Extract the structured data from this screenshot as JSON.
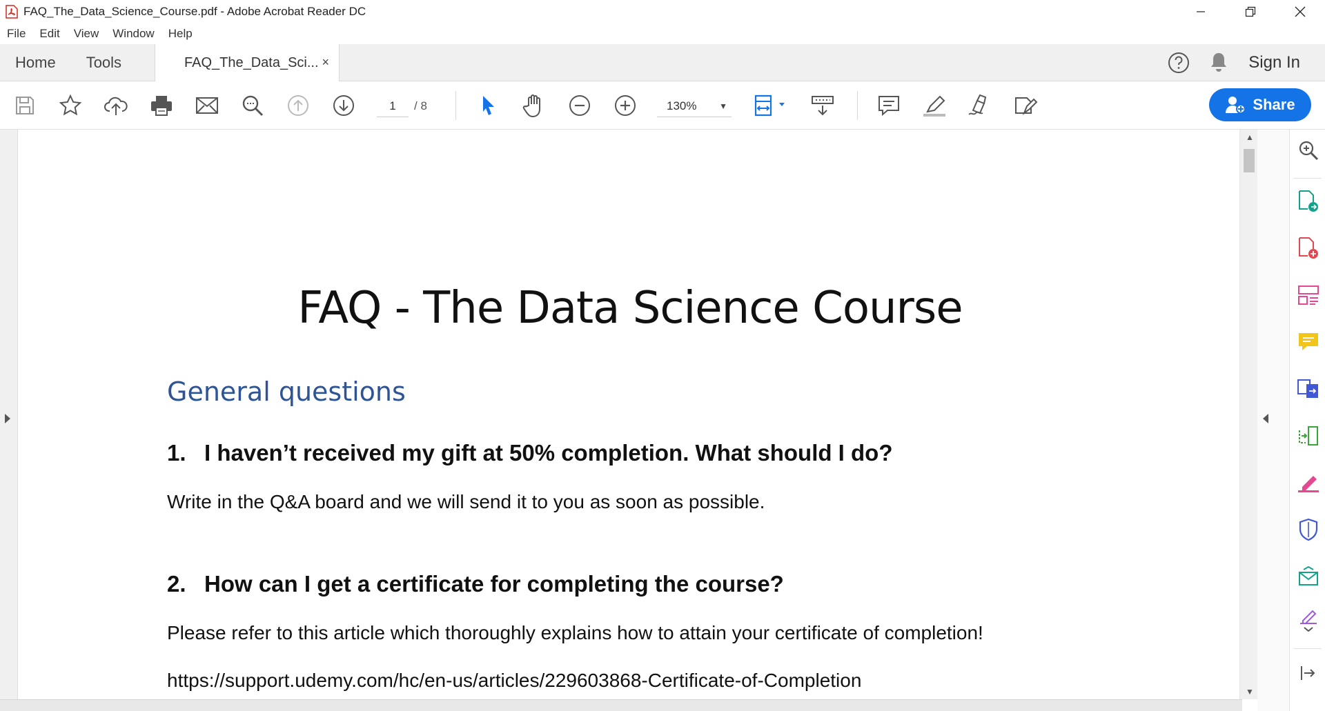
{
  "window": {
    "title": "FAQ_The_Data_Science_Course.pdf - Adobe Acrobat Reader DC"
  },
  "menu": [
    "File",
    "Edit",
    "View",
    "Window",
    "Help"
  ],
  "tabs": {
    "home": "Home",
    "tools": "Tools",
    "document": "FAQ_The_Data_Sci...",
    "close": "×",
    "sign_in": "Sign In"
  },
  "toolbar": {
    "current_page": "1",
    "total_pages": "/ 8",
    "zoom": "130%",
    "share_label": "Share"
  },
  "document": {
    "title": "FAQ - The Data Science Course",
    "section": "General questions",
    "questions": [
      {
        "number": "1.",
        "question": "I haven’t received my gift at 50% completion. What should I do?",
        "answers": [
          "Write in the Q&A board and we will send it to you as soon as possible."
        ]
      },
      {
        "number": "2.",
        "question": "How can I get a certificate for completing the course?",
        "answers": [
          "Please refer to this article which thoroughly explains how to attain your certificate of completion!",
          "https://support.udemy.com/hc/en-us/articles/229603868-Certificate-of-Completion"
        ]
      }
    ]
  },
  "colors": {
    "accent": "#1473e6",
    "heading_blue": "#2f5496"
  }
}
